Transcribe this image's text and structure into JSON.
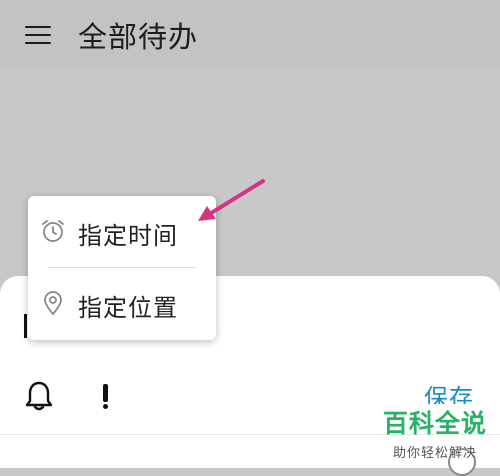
{
  "header": {
    "title": "全部待办",
    "menu_icon": "hamburger-menu-icon"
  },
  "popup": {
    "items": [
      {
        "label": "指定时间",
        "icon": "alarm-clock-icon"
      },
      {
        "label": "指定位置",
        "icon": "location-pin-icon"
      }
    ]
  },
  "toolbar": {
    "reminder_icon": "bell-icon",
    "priority_icon": "exclamation-icon",
    "save_label": "保存"
  },
  "annotation": {
    "arrow_color": "#d63384"
  },
  "watermark": {
    "main": "百科全说",
    "sub": "助你轻松解决"
  },
  "colors": {
    "accent": "#1a8cc4",
    "watermark_green": "#27b267"
  }
}
